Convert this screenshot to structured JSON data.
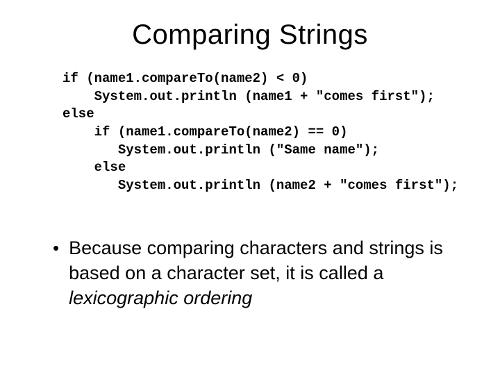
{
  "title": "Comparing Strings",
  "code": {
    "l1": "if (name1.compareTo(name2) < 0)",
    "l2": "    System.out.println (name1 + \"comes first\");",
    "l3": "else",
    "l4": "    if (name1.compareTo(name2) == 0)",
    "l5": "       System.out.println (\"Same name\");",
    "l6": "    else",
    "l7": "       System.out.println (name2 + \"comes first\");"
  },
  "bullet": {
    "dot": "•",
    "part1": "Because comparing characters and strings is based on a character set, it is called a ",
    "italic": "lexicographic ordering"
  }
}
